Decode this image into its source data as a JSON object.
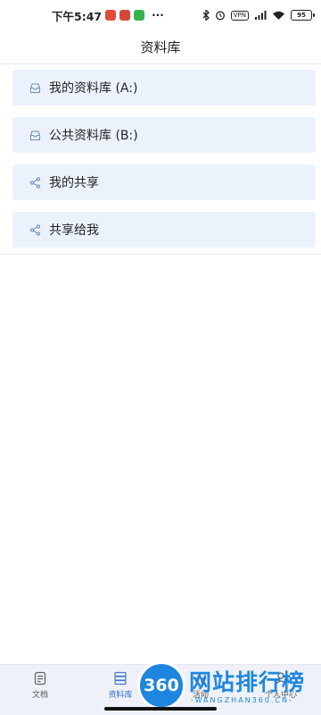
{
  "status_bar": {
    "time": "下午5:47",
    "more": "···",
    "vpn": "VPN",
    "battery": "95"
  },
  "header": {
    "title": "资料库"
  },
  "items": [
    {
      "label": "我的资料库 (A:)",
      "icon": "library-icon"
    },
    {
      "label": "公共资料库 (B:)",
      "icon": "library-icon"
    },
    {
      "label": "我的共享",
      "icon": "share-icon"
    },
    {
      "label": "共享给我",
      "icon": "share-icon"
    }
  ],
  "nav": [
    {
      "label": "文档",
      "icon": "document-icon",
      "active": false
    },
    {
      "label": "资料库",
      "icon": "library-icon",
      "active": true
    },
    {
      "label": "活动",
      "icon": "activity-icon",
      "active": false
    },
    {
      "label": "个人中心",
      "icon": "person-icon",
      "active": false
    }
  ],
  "watermark": {
    "badge": "360",
    "title": "网站排行榜",
    "subtitle": "-WANGZHAN360.CN-"
  },
  "colors": {
    "accent": "#2d6fd6",
    "item_bg": "#ecf2fc",
    "nav_bg": "#eef2f8",
    "watermark": "#1f86e0"
  }
}
